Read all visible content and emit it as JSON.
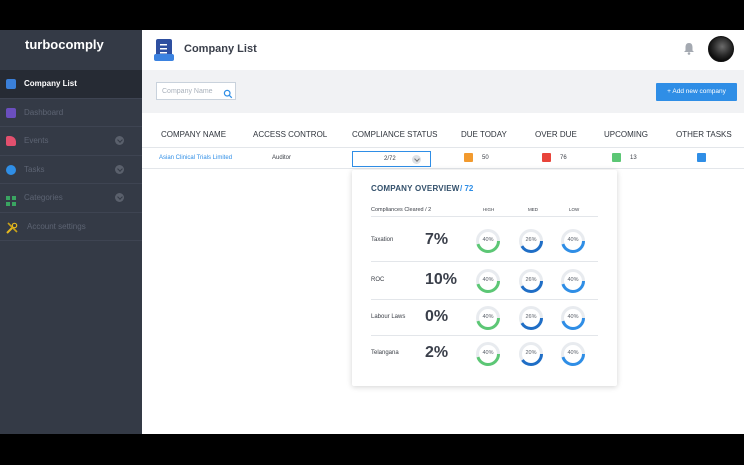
{
  "app": {
    "logo": "turbocomply"
  },
  "sidebar": {
    "items": [
      {
        "label": "Company List",
        "icon": "company-list-icon",
        "color": "#3a7fd8",
        "active": true,
        "chevron": false
      },
      {
        "label": "Dashboard",
        "icon": "dashboard-icon",
        "color": "#6b4fbf",
        "active": false,
        "chevron": false
      },
      {
        "label": "Events",
        "icon": "events-icon",
        "color": "#e2506e",
        "active": false,
        "chevron": true
      },
      {
        "label": "Tasks",
        "icon": "tasks-icon",
        "color": "#2f8ee6",
        "active": false,
        "chevron": true
      },
      {
        "label": "Categories",
        "icon": "categories-icon",
        "color": "#3aa561",
        "active": false,
        "chevron": true
      },
      {
        "label": "Account settings",
        "icon": "tools-icon",
        "color": "#e6b91e",
        "active": false,
        "chevron": false
      }
    ]
  },
  "header": {
    "title": "Company List",
    "icon": "company-list-icon",
    "bell_icon": "bell-icon"
  },
  "toolbar": {
    "search_placeholder": "Company Name",
    "add_button": "+ Add new company"
  },
  "table": {
    "columns": [
      "COMPANY NAME",
      "ACCESS CONTROL",
      "COMPLIANCE STATUS",
      "DUE TODAY",
      "OVER DUE",
      "UPCOMING",
      "OTHER TASKS"
    ],
    "rows": [
      {
        "company": "Asian Clinical Trials Limited",
        "access": "Auditor",
        "status": "2/72",
        "due_today": "50",
        "over_due": "76",
        "upcoming": "13",
        "colors": {
          "due_today": "#f29a2e",
          "over_due": "#e8443a",
          "upcoming": "#5cc775",
          "other": "#2f8ee6"
        }
      }
    ]
  },
  "overview": {
    "title": "COMPANY OVERVIEW",
    "total": "/ 72",
    "subtitle": "Compliances Cleared / 2",
    "columns": [
      "HIGH",
      "MED",
      "LOW"
    ],
    "rows": [
      {
        "label": "Taxation",
        "percent": "7%",
        "donuts": [
          {
            "label": "40%",
            "value": 40,
            "color": "#5cc775"
          },
          {
            "label": "26%",
            "value": 26,
            "color": "#1f6ec6"
          },
          {
            "label": "40%",
            "value": 40,
            "color": "#2f8ee6"
          }
        ]
      },
      {
        "label": "ROC",
        "percent": "10%",
        "donuts": [
          {
            "label": "40%",
            "value": 40,
            "color": "#5cc775"
          },
          {
            "label": "26%",
            "value": 26,
            "color": "#1f6ec6"
          },
          {
            "label": "40%",
            "value": 40,
            "color": "#2f8ee6"
          }
        ]
      },
      {
        "label": "Labour Laws",
        "percent": "0%",
        "donuts": [
          {
            "label": "40%",
            "value": 40,
            "color": "#5cc775"
          },
          {
            "label": "26%",
            "value": 26,
            "color": "#1f6ec6"
          },
          {
            "label": "40%",
            "value": 40,
            "color": "#2f8ee6"
          }
        ]
      },
      {
        "label": "Telangana",
        "percent": "2%",
        "donuts": [
          {
            "label": "40%",
            "value": 40,
            "color": "#5cc775"
          },
          {
            "label": "20%",
            "value": 20,
            "color": "#1f6ec6"
          },
          {
            "label": "40%",
            "value": 40,
            "color": "#2f8ee6"
          }
        ]
      }
    ]
  }
}
